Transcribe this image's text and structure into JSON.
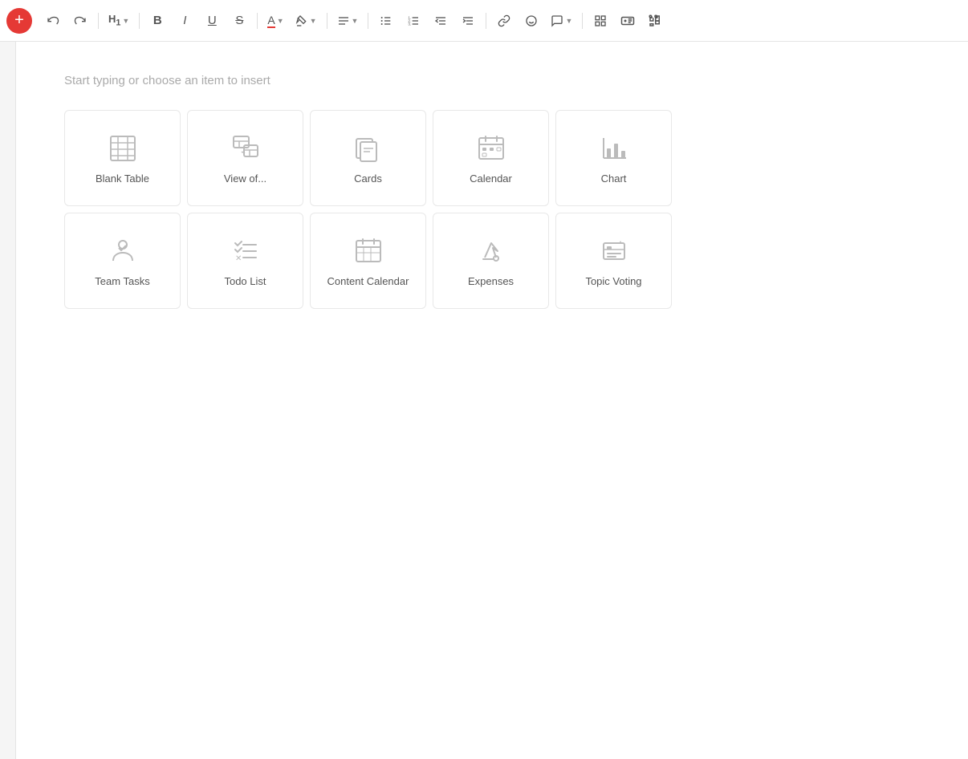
{
  "toolbar": {
    "add_label": "+",
    "undo_label": "↩",
    "redo_label": "↪",
    "heading_label": "H₁",
    "bold_label": "B",
    "italic_label": "I",
    "underline_label": "U",
    "strikethrough_label": "S",
    "font_color_label": "A",
    "highlight_label": "✏",
    "align_label": "≡",
    "bullets_label": "≔",
    "numbered_label": "≔",
    "outdent_label": "⇤",
    "indent_label": "⇥",
    "link_label": "🔗",
    "emoji_label": "☺",
    "comment_label": "💬",
    "table_view_label": "⊞",
    "ai_label": "🤖",
    "puzzle_label": "✦"
  },
  "editor": {
    "placeholder": "Start typing or choose an item to insert"
  },
  "grid_items": [
    {
      "id": "blank-table",
      "label": "Blank Table",
      "icon": "table"
    },
    {
      "id": "view-of",
      "label": "View of...",
      "icon": "view"
    },
    {
      "id": "cards",
      "label": "Cards",
      "icon": "cards"
    },
    {
      "id": "calendar",
      "label": "Calendar",
      "icon": "calendar"
    },
    {
      "id": "chart",
      "label": "Chart",
      "icon": "chart"
    },
    {
      "id": "team-tasks",
      "label": "Team Tasks",
      "icon": "team-tasks"
    },
    {
      "id": "todo-list",
      "label": "Todo List",
      "icon": "todo"
    },
    {
      "id": "content-calendar",
      "label": "Content Calendar",
      "icon": "content-calendar"
    },
    {
      "id": "expenses",
      "label": "Expenses",
      "icon": "expenses"
    },
    {
      "id": "topic-voting",
      "label": "Topic Voting",
      "icon": "topic-voting"
    }
  ]
}
